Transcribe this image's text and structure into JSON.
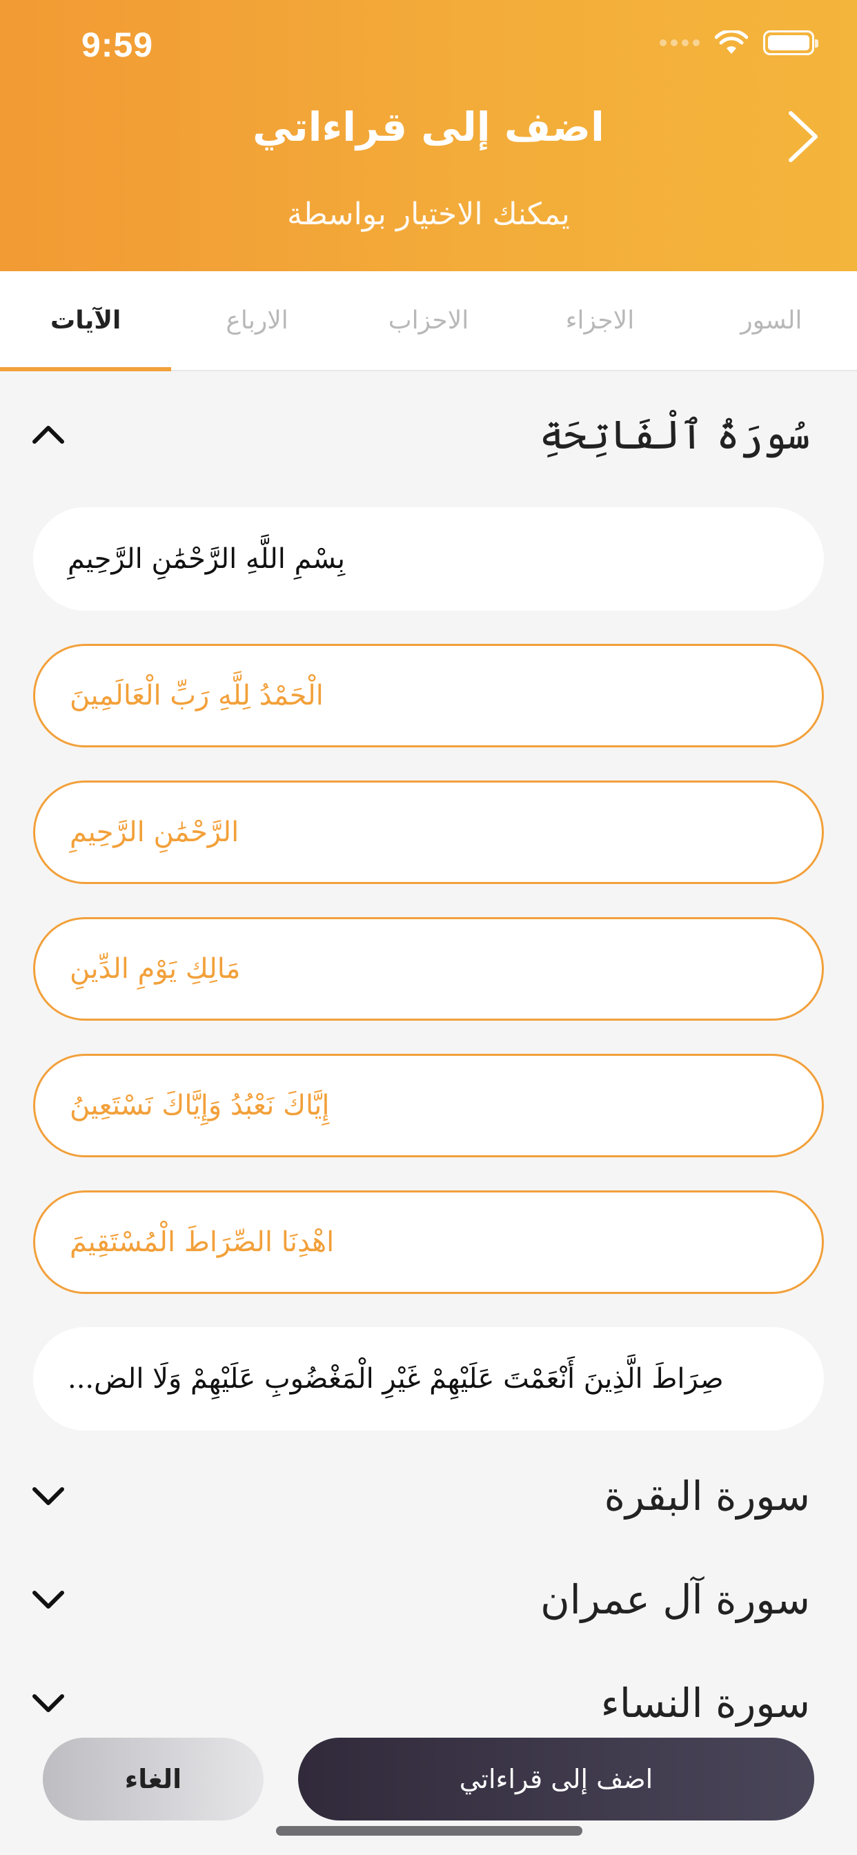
{
  "status_bar": {
    "time": "9:59"
  },
  "header": {
    "title": "اضف إلى قراءاتي",
    "subtitle": "يمكنك الاختيار بواسطة"
  },
  "tabs": [
    {
      "label": "الآيات",
      "active": true
    },
    {
      "label": "الارباع",
      "active": false
    },
    {
      "label": "الاحزاب",
      "active": false
    },
    {
      "label": "الاجزاء",
      "active": false
    },
    {
      "label": "السور",
      "active": false
    }
  ],
  "surahs": {
    "fatiha": {
      "title": "سُورَةُ ٱلْفَاتِحَةِ",
      "expanded": true,
      "ayat": [
        {
          "text": "بِسْمِ اللَّهِ الرَّحْمَٰنِ الرَّحِيمِ",
          "selected": false
        },
        {
          "text": "الْحَمْدُ لِلَّهِ رَبِّ الْعَالَمِينَ",
          "selected": true
        },
        {
          "text": "الرَّحْمَٰنِ الرَّحِيمِ",
          "selected": true
        },
        {
          "text": "مَالِكِ يَوْمِ الدِّينِ",
          "selected": true
        },
        {
          "text": "إِيَّاكَ نَعْبُدُ وَإِيَّاكَ نَسْتَعِينُ",
          "selected": true
        },
        {
          "text": "اهْدِنَا الصِّرَاطَ الْمُسْتَقِيمَ",
          "selected": true
        },
        {
          "text": "صِرَاطَ الَّذِينَ أَنْعَمْتَ عَلَيْهِمْ غَيْرِ الْمَغْضُوبِ عَلَيْهِمْ وَلَا الض...",
          "selected": false
        }
      ]
    },
    "baqarah": {
      "title": "سورة البقرة",
      "expanded": false
    },
    "imran": {
      "title": "سورة آل عمران",
      "expanded": false
    },
    "nisa": {
      "title": "سورة النساء",
      "expanded": false
    }
  },
  "actions": {
    "cancel_label": "الغاء",
    "add_label": "اضف إلى قراءاتي"
  },
  "colors": {
    "accent": "#f2a03a",
    "header_start": "#f29a34",
    "header_end": "#f4b53c",
    "primary_button": "#3a3446"
  }
}
